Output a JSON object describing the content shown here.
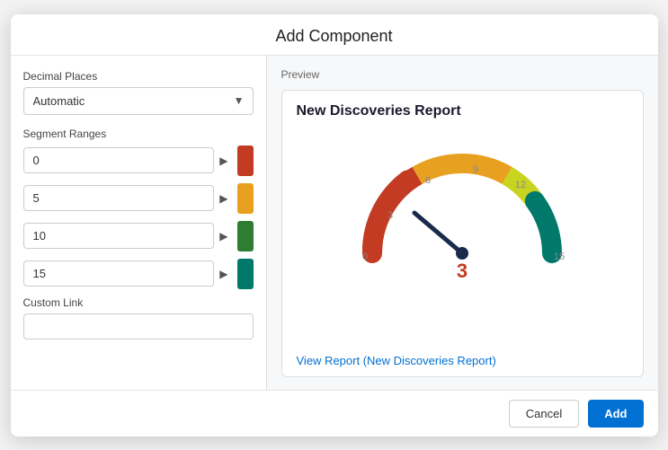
{
  "dialog": {
    "title": "Add Component"
  },
  "left": {
    "decimal_places_label": "Decimal Places",
    "decimal_places_value": "Automatic",
    "segment_ranges_label": "Segment Ranges",
    "segments": [
      {
        "value": "0",
        "color": "#c23b22",
        "color_name": "red"
      },
      {
        "value": "5",
        "color": "#e8a020",
        "color_name": "orange"
      },
      {
        "value": "10",
        "color": "#2e7d32",
        "color_name": "dark-green"
      },
      {
        "value": "15",
        "color": "#00796b",
        "color_name": "teal"
      }
    ],
    "custom_link_label": "Custom Link",
    "custom_link_placeholder": ""
  },
  "right": {
    "preview_label": "Preview",
    "chart_title": "New Discoveries Report",
    "gauge_value": "3",
    "gauge_value_color": "#c23b22",
    "view_report_link": "View Report (New Discoveries Report)"
  },
  "footer": {
    "cancel_label": "Cancel",
    "add_label": "Add"
  }
}
